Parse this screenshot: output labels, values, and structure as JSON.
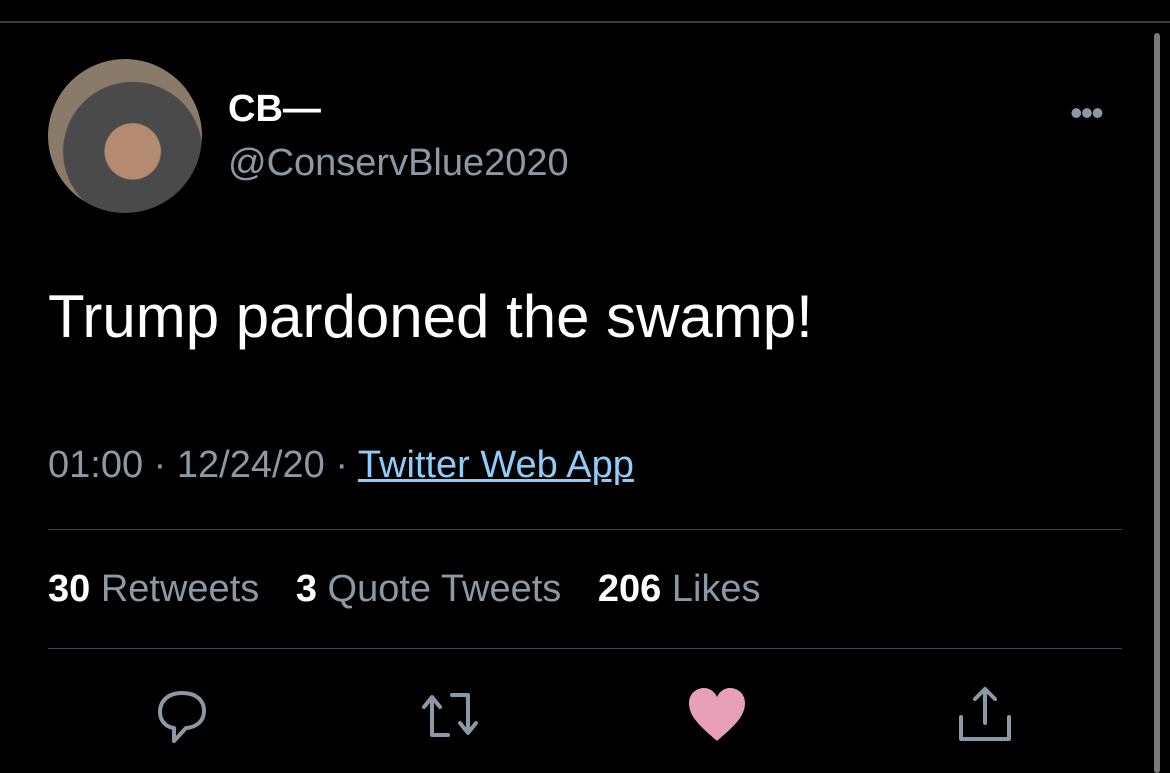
{
  "tweet": {
    "display_name": "CB—",
    "handle": "@ConservBlue2020",
    "text": "Trump pardoned the swamp!",
    "time": "01:00",
    "date": "12/24/20",
    "source": "Twitter Web App",
    "separator": "·",
    "more_icon": "•••"
  },
  "stats": {
    "retweets_count": "30",
    "retweets_label": "Retweets",
    "quotes_count": "3",
    "quotes_label": "Quote Tweets",
    "likes_count": "206",
    "likes_label": "Likes"
  },
  "actions": [
    "reply-icon",
    "retweet-icon",
    "heart-icon",
    "share-icon"
  ],
  "colors": {
    "background": "#000000",
    "secondary": "#8b98a5",
    "link": "#8ecdf8",
    "liked": "#e8a0b8"
  }
}
